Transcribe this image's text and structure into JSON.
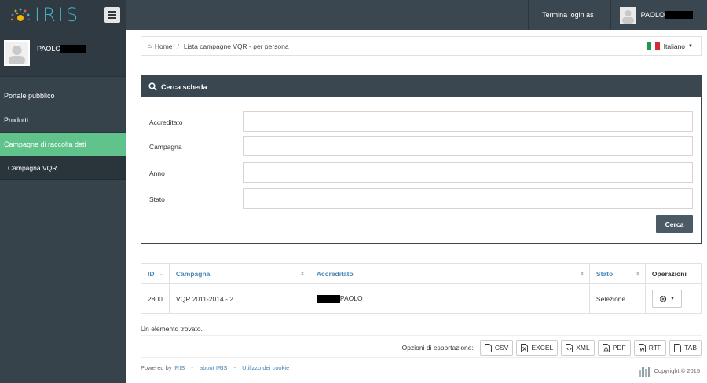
{
  "header": {
    "logo_text": "IRIS",
    "logout_as_label": "Termina login as",
    "user_name": "PAOLO"
  },
  "sidebar": {
    "user_name": "PAOLO",
    "items": [
      {
        "label": "Portale pubblico"
      },
      {
        "label": "Prodotti"
      },
      {
        "label": "Campagne di raccolta dati"
      }
    ],
    "sub_items": [
      {
        "label": "Campagna VQR"
      }
    ]
  },
  "breadcrumb": {
    "home": "Home",
    "current": "Lista campagne VQR - per persona",
    "language": "Italiano"
  },
  "search_panel": {
    "title": "Cerca scheda",
    "fields": [
      {
        "label": "Accreditato",
        "value": ""
      },
      {
        "label": "Campagna",
        "value": ""
      },
      {
        "label": "Anno",
        "value": ""
      },
      {
        "label": "Stato",
        "value": ""
      }
    ],
    "submit_label": "Cerca"
  },
  "table": {
    "columns": [
      "ID",
      "Campagna",
      "Accreditato",
      "Stato",
      "Operazioni"
    ],
    "rows": [
      {
        "id": "2800",
        "campagna": "VQR 2011-2014 - 2",
        "accreditato": "PAOLO",
        "stato": "Selezione"
      }
    ]
  },
  "results_summary": "Un elemento trovato.",
  "export": {
    "label": "Opzioni di esportazione:",
    "formats": [
      "CSV",
      "EXCEL",
      "XML",
      "PDF",
      "RTF",
      "TAB"
    ]
  },
  "footer": {
    "powered_by": "Powered by",
    "links": [
      "IRIS",
      "about IRIS",
      "Utilizzo dei cookie"
    ],
    "copyright": "Copyright © 2015"
  },
  "colors": {
    "topbar": "#3b4750",
    "sidebar": "#37434b",
    "active_item": "#60c38c",
    "link": "#4a86b6"
  }
}
